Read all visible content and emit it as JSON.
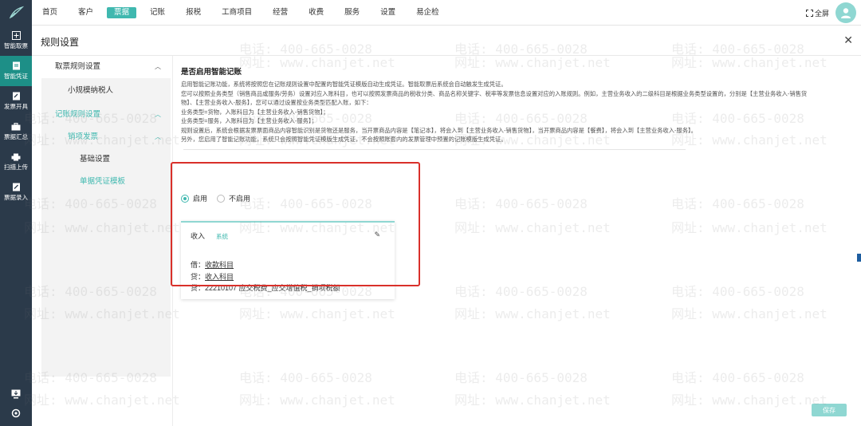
{
  "topnav": {
    "items": [
      "首页",
      "客户",
      "票据",
      "记账",
      "报税",
      "工商项目",
      "经营",
      "收费",
      "服务",
      "设置",
      "易企检"
    ],
    "active_index": 2,
    "fullscreen_label": "全屏"
  },
  "rail": {
    "items": [
      "智能取票",
      "智能凭证",
      "发票开具",
      "票据汇总",
      "扫描上传",
      "票据录入"
    ],
    "active_index": 1
  },
  "panel": {
    "title": "规则设置"
  },
  "sidenav": {
    "group1": "取票规则设置",
    "group1_item": "小规模纳税人",
    "group2": "记账规则设置",
    "sub": "销项发票",
    "leaf1": "基础设置",
    "leaf2": "单据凭证模板"
  },
  "content": {
    "title": "是否启用智能记账",
    "desc": [
      "启用智能记账功能，系统将按照您在记账规则设置中配置的智能凭证模版自动生成凭证。智能取票后系统会自动触发生成凭证。",
      "您可以按照业务类型（销售商品或服务/劳务）设置对应入账科目，也可以按照发票商品的税收分类、商品名称关键字、税率等发票信息设置对应的入账规则。例如，主营业务收入的二级科目是根据业务类型设置的，分别是【主营业务收入-销售货",
      "物】、【主营业务收入-服务】，您可以通过设置按业务类型匹配入账，如下：",
      "业务类型=货物，入账科目为【主营业务收入-销售货物】；",
      "业务类型=服务，入账科目为【主营业务收入-服务】；",
      "规则设置后，系统会根据发票票面商品内容智能识别是货物还是服务，当开票商品内容是【笔记本】，将会入到【主营业务收入-销售货物】，当开票商品内容是【餐费】，将会入到【主营业务收入-服务】。",
      "另外，您启用了智能记账功能，系统只会按照智能凭证模版生成凭证，不会按照账套内的发票管理中预置的记账模版生成凭证。"
    ],
    "radio_on": "启用",
    "radio_off": "不启用"
  },
  "card": {
    "tab": "收入",
    "tag": "系统",
    "debit_prefix": "借：",
    "debit_link": "收款科目",
    "credit1_prefix": "贷：",
    "credit1_link": "收入科目",
    "credit2": "贷：22210107 应交税费_应交增值税_销项税额"
  },
  "save_label": "保存",
  "watermark": {
    "phone": "电话: 400-665-0028",
    "site": "网址: www.chanjet.net"
  },
  "colors": {
    "accent": "#3fb8af",
    "rail": "#2b3a4a",
    "highlight": "#d9302a"
  }
}
